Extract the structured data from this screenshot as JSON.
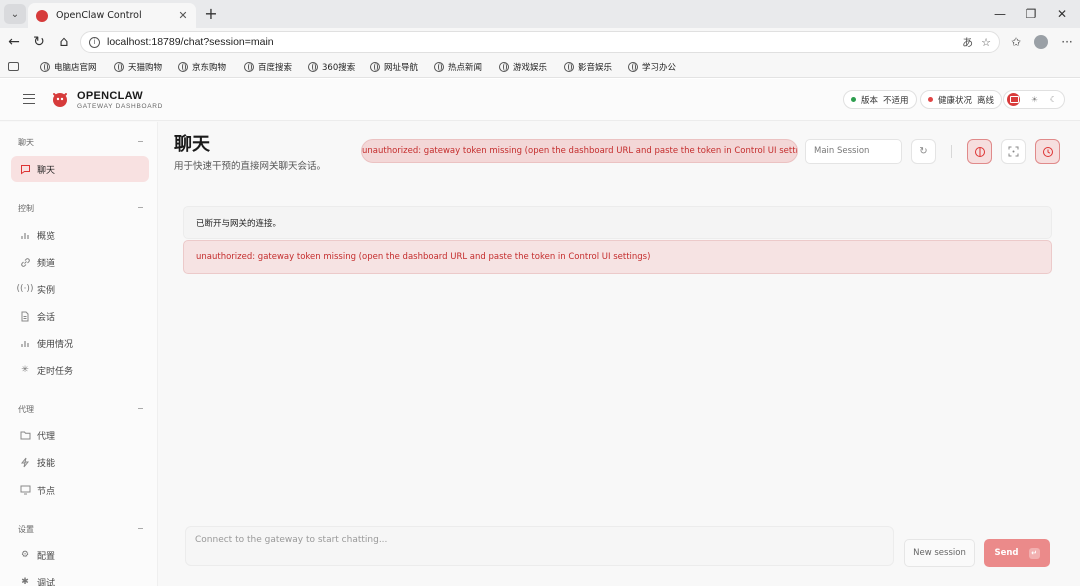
{
  "browser": {
    "tab_title": "OpenClaw Control",
    "url": "localhost:18789/chat?session=main",
    "bookmarks": [
      "电脑店官网",
      "天猫购物",
      "京东购物",
      "百度搜索",
      "360搜索",
      "网址导航",
      "热点新闻",
      "游戏娱乐",
      "影音娱乐",
      "学习办公"
    ]
  },
  "header": {
    "brand_name": "OPENCLAW",
    "brand_sub": "GATEWAY DASHBOARD",
    "version_label": "版本",
    "version_value": "不适用",
    "health_label": "健康状况",
    "health_value": "离线",
    "colors": {
      "accent": "#d83a3a",
      "online_dot": "#2e9e4f",
      "offline_dot": "#e04545"
    }
  },
  "sidebar": {
    "sections": [
      {
        "title": "聊天",
        "items": [
          {
            "label": "聊天",
            "icon": "chat-bubble-icon",
            "active": true
          }
        ]
      },
      {
        "title": "控制",
        "items": [
          {
            "label": "概览",
            "icon": "bar-chart-icon"
          },
          {
            "label": "频道",
            "icon": "link-icon"
          },
          {
            "label": "实例",
            "icon": "broadcast-icon"
          },
          {
            "label": "会话",
            "icon": "document-icon"
          },
          {
            "label": "使用情况",
            "icon": "bar-chart-icon"
          },
          {
            "label": "定时任务",
            "icon": "loader-icon"
          }
        ]
      },
      {
        "title": "代理",
        "items": [
          {
            "label": "代理",
            "icon": "folder-icon"
          },
          {
            "label": "技能",
            "icon": "lightning-icon"
          },
          {
            "label": "节点",
            "icon": "monitor-icon"
          }
        ]
      },
      {
        "title": "设置",
        "items": [
          {
            "label": "配置",
            "icon": "gear-icon"
          },
          {
            "label": "调试",
            "icon": "bug-icon"
          }
        ]
      }
    ]
  },
  "main": {
    "title": "聊天",
    "subtitle": "用于快速干预的直接网关聊天会话。",
    "error_banner": "unauthorized: gateway token missing (open the dashboard URL and paste the token in Control UI settings)",
    "session_value": "Main Session",
    "messages": [
      {
        "type": "info",
        "text": "已断开与网关的连接。"
      },
      {
        "type": "error",
        "text": "unauthorized: gateway token missing (open the dashboard URL and paste the token in Control UI settings)"
      }
    ],
    "compose_placeholder": "Connect to the gateway to start chatting...",
    "new_session_label": "New session",
    "send_label": "Send"
  }
}
